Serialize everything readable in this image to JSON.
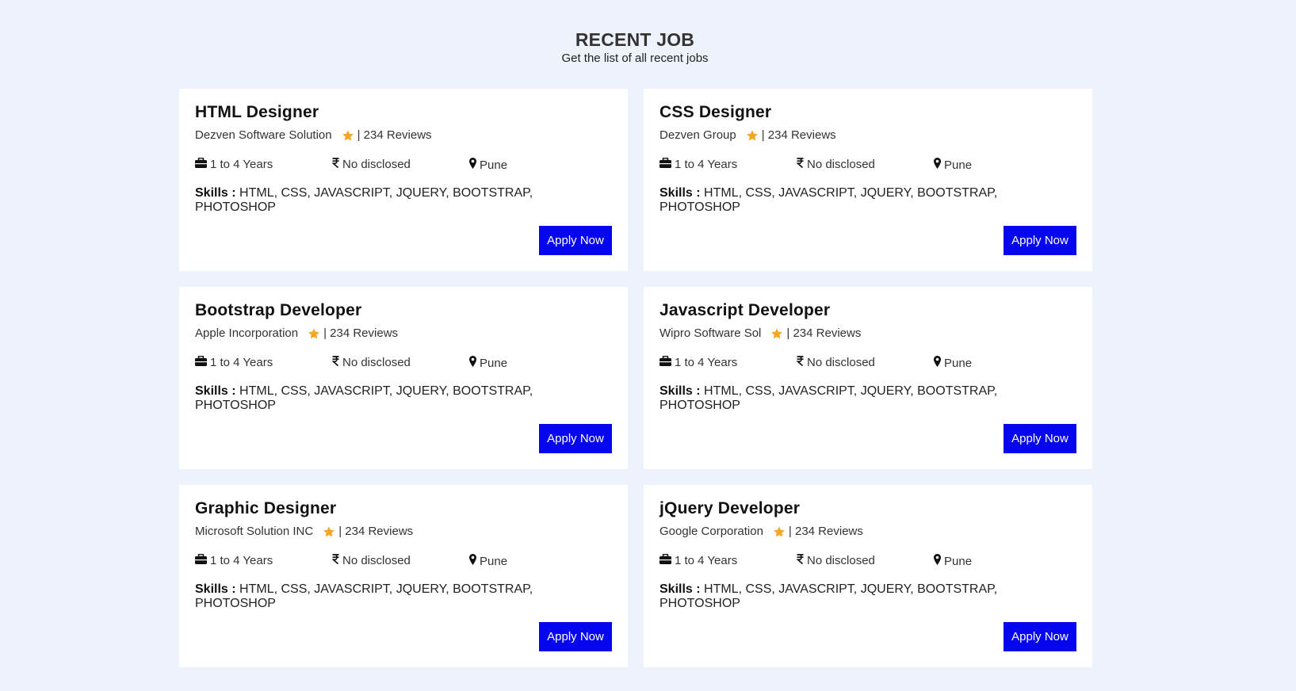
{
  "header": {
    "title": "RECENT JOB",
    "subtitle": "Get the list of all recent jobs"
  },
  "colors": {
    "background": "#eef2fb",
    "card": "#ffffff",
    "accent_button": "#0505ee",
    "star": "#f5a623"
  },
  "icons": {
    "rating": "star-icon",
    "experience": "briefcase-icon",
    "salary": "rupee-icon",
    "location": "map-marker-icon"
  },
  "jobs": [
    {
      "title": "HTML Designer",
      "company": "Dezven Software Solution",
      "reviews": "| 234 Reviews",
      "experience": "1 to 4 Years",
      "salary": "No disclosed",
      "location": "Pune",
      "skills_label": "Skills :",
      "skills": "HTML, CSS, JAVASCRIPT, JQUERY, BOOTSTRAP, PHOTOSHOP",
      "apply_label": "Apply Now"
    },
    {
      "title": "CSS Designer",
      "company": "Dezven Group",
      "reviews": "| 234 Reviews",
      "experience": "1 to 4 Years",
      "salary": "No disclosed",
      "location": "Pune",
      "skills_label": "Skills :",
      "skills": "HTML, CSS, JAVASCRIPT, JQUERY, BOOTSTRAP, PHOTOSHOP",
      "apply_label": "Apply Now"
    },
    {
      "title": "Bootstrap Developer",
      "company": "Apple Incorporation",
      "reviews": "| 234 Reviews",
      "experience": "1 to 4 Years",
      "salary": "No disclosed",
      "location": "Pune",
      "skills_label": "Skills :",
      "skills": "HTML, CSS, JAVASCRIPT, JQUERY, BOOTSTRAP, PHOTOSHOP",
      "apply_label": "Apply Now"
    },
    {
      "title": "Javascript Developer",
      "company": "Wipro Software Sol",
      "reviews": "| 234 Reviews",
      "experience": "1 to 4 Years",
      "salary": "No disclosed",
      "location": "Pune",
      "skills_label": "Skills :",
      "skills": "HTML, CSS, JAVASCRIPT, JQUERY, BOOTSTRAP, PHOTOSHOP",
      "apply_label": "Apply Now"
    },
    {
      "title": "Graphic Designer",
      "company": "Microsoft Solution INC",
      "reviews": "| 234 Reviews",
      "experience": "1 to 4 Years",
      "salary": "No disclosed",
      "location": "Pune",
      "skills_label": "Skills :",
      "skills": "HTML, CSS, JAVASCRIPT, JQUERY, BOOTSTRAP, PHOTOSHOP",
      "apply_label": "Apply Now"
    },
    {
      "title": "jQuery Developer",
      "company": "Google Corporation",
      "reviews": "| 234 Reviews",
      "experience": "1 to 4 Years",
      "salary": "No disclosed",
      "location": "Pune",
      "skills_label": "Skills :",
      "skills": "HTML, CSS, JAVASCRIPT, JQUERY, BOOTSTRAP, PHOTOSHOP",
      "apply_label": "Apply Now"
    }
  ]
}
